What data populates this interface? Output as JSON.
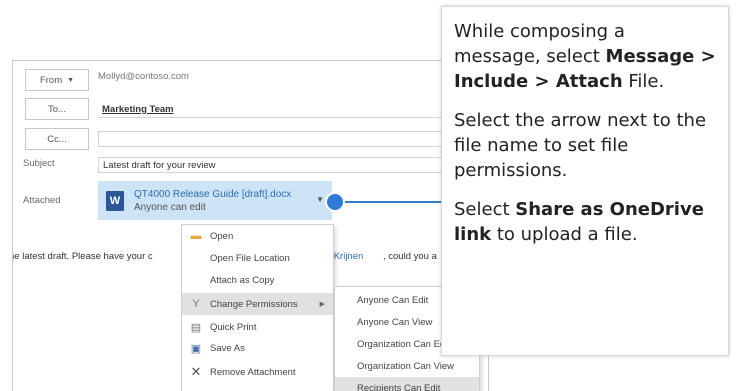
{
  "compose": {
    "from_label": "From",
    "from_value": "Mollyd@contoso.com",
    "to_label": "To...",
    "to_value": "Marketing Team",
    "cc_label": "Cc...",
    "cc_value": "",
    "subject_label": "Subject",
    "subject_value": "Latest draft for your review",
    "attached_label": "Attached",
    "attachment": {
      "filename": "QT4000 Release Guide [draft].docx",
      "permission": "Anyone can edit",
      "icon": "word-icon"
    },
    "body_start": "he latest draft. Please have your c",
    "body_link": "Tony Krijnen",
    "body_tail": ", could you a"
  },
  "context_menu": {
    "items": [
      {
        "label": "Open",
        "icon": "folder-icon"
      },
      {
        "label": "Open File Location",
        "icon": ""
      },
      {
        "label": "Attach as Copy",
        "icon": ""
      },
      {
        "label": "Change Permissions",
        "icon": "permissions-icon"
      },
      {
        "label": "Quick Print",
        "icon": "printer-icon"
      },
      {
        "label": "Save As",
        "icon": "save-icon"
      },
      {
        "label": "Remove Attachment",
        "icon": "close-icon"
      }
    ]
  },
  "permissions_submenu": {
    "items": [
      "Anyone Can Edit",
      "Anyone Can View",
      "Organization Can Edit",
      "Organization Can View",
      "Recipients Can Edit"
    ]
  },
  "callout": {
    "p1_text": "While composing a message, select ",
    "p1_bold": "Message > Include > Attach",
    "p1_tail": " File.",
    "p2": "Select the arrow next to the file name to set file permissions.",
    "p3_text": "Select ",
    "p3_bold": "Share as OneDrive link",
    "p3_tail": " to upload a file."
  },
  "colors": {
    "accent": "#2f7ad6",
    "attachment_highlight": "#cde4f7",
    "word_blue": "#2b579a"
  }
}
